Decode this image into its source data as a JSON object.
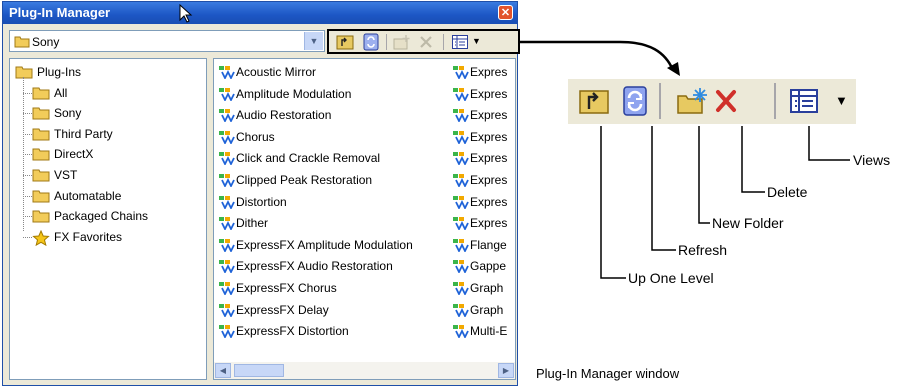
{
  "window": {
    "title": "Plug-In Manager",
    "close_label": "✕"
  },
  "location": {
    "value": "Sony"
  },
  "tree": {
    "root": "Plug-Ins",
    "children": [
      "All",
      "Sony",
      "Third Party",
      "DirectX",
      "VST",
      "Automatable",
      "Packaged Chains",
      "FX Favorites"
    ]
  },
  "list": {
    "col1": [
      "Acoustic Mirror",
      "Amplitude Modulation",
      "Audio Restoration",
      "Chorus",
      "Click and Crackle Removal",
      "Clipped Peak Restoration",
      "Distortion",
      "Dither",
      "ExpressFX Amplitude Modulation",
      "ExpressFX Audio Restoration",
      "ExpressFX Chorus",
      "ExpressFX Delay",
      "ExpressFX Distortion"
    ],
    "col2": [
      "Expres",
      "Expres",
      "Expres",
      "Expres",
      "Expres",
      "Expres",
      "Expres",
      "Expres",
      "Flange",
      "Gappe",
      "Graph",
      "Graph",
      "Multi-E"
    ]
  },
  "toolbar_zoom": {
    "icons": [
      "up-one-level-icon",
      "refresh-icon",
      "new-folder-icon",
      "delete-icon",
      "views-icon"
    ]
  },
  "callouts": {
    "views": "Views",
    "delete": "Delete",
    "new_folder": "New Folder",
    "refresh": "Refresh",
    "up_one_level": "Up One Level"
  },
  "caption": "Plug-In Manager window",
  "colors": {
    "titlebar": "#1c56c4",
    "window_bg": "#ece9d8",
    "delete_red": "#d0302a",
    "folder_yellow": "#f2cc5a",
    "refresh_blue": "#3f5fd8"
  }
}
